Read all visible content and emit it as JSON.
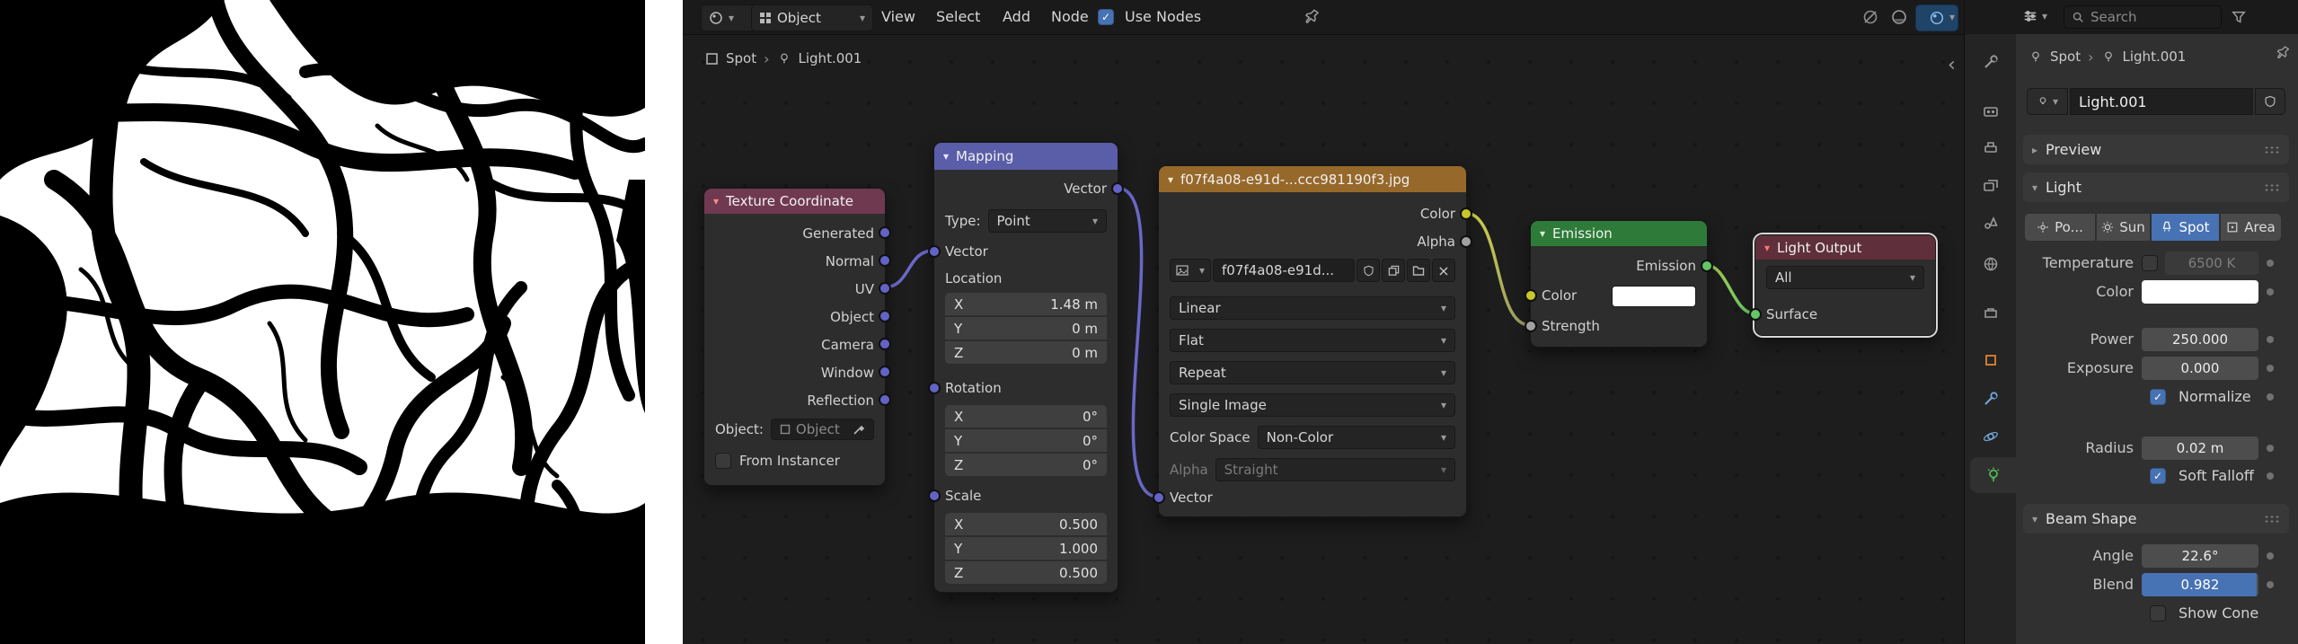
{
  "icons": {
    "chevron_down": "▾",
    "chevron_right": "▸",
    "chevron_left": "‹",
    "breadcrumb_sep": "›",
    "check": "✓",
    "close": "×"
  },
  "node_editor": {
    "header": {
      "mode": "Object",
      "menu_view": "View",
      "menu_select": "Select",
      "menu_add": "Add",
      "menu_node": "Node",
      "use_nodes_label": "Use Nodes"
    },
    "breadcrumb": {
      "scene": "Spot",
      "object": "Light.001"
    },
    "nodes": {
      "texture_coordinate": {
        "title": "Texture Coordinate",
        "outputs": [
          "Generated",
          "Normal",
          "UV",
          "Object",
          "Camera",
          "Window",
          "Reflection"
        ],
        "object_label": "Object:",
        "object_value": "Object",
        "from_instancer": "From Instancer"
      },
      "mapping": {
        "title": "Mapping",
        "output": "Vector",
        "type_label": "Type:",
        "type_value": "Point",
        "vector_label": "Vector",
        "location_label": "Location",
        "rotation_label": "Rotation",
        "scale_label": "Scale",
        "axis_x": "X",
        "axis_y": "Y",
        "axis_z": "Z",
        "location": {
          "x": "1.48 m",
          "y": "0 m",
          "z": "0 m"
        },
        "rotation": {
          "x": "0°",
          "y": "0°",
          "z": "0°"
        },
        "scale": {
          "x": "0.500",
          "y": "1.000",
          "z": "0.500"
        }
      },
      "image_texture": {
        "title": "f07f4a08-e91d-...ccc981190f3.jpg",
        "output_color": "Color",
        "output_alpha": "Alpha",
        "image_name": "f07f4a08-e91d...",
        "interpolation": "Linear",
        "projection": "Flat",
        "extension": "Repeat",
        "source": "Single Image",
        "color_space_label": "Color Space",
        "color_space_value": "Non-Color",
        "alpha_label": "Alpha",
        "alpha_value": "Straight",
        "input": "Vector"
      },
      "emission": {
        "title": "Emission",
        "output": "Emission",
        "color_label": "Color",
        "strength_label": "Strength"
      },
      "light_output": {
        "title": "Light Output",
        "target": "All",
        "input": "Surface"
      }
    }
  },
  "properties": {
    "search_placeholder": "Search",
    "breadcrumb": {
      "scene": "Spot",
      "object": "Light.001"
    },
    "name_value": "Light.001",
    "panels": {
      "preview": "Preview",
      "light": "Light",
      "beam_shape": "Beam Shape"
    },
    "light_types": {
      "point": "Po...",
      "sun": "Sun",
      "spot": "Spot",
      "area": "Area"
    },
    "temperature": {
      "label": "Temperature",
      "value": "6500 K"
    },
    "color_label": "Color",
    "power": {
      "label": "Power",
      "value": "250.000"
    },
    "exposure": {
      "label": "Exposure",
      "value": "0.000"
    },
    "normalize_label": "Normalize",
    "radius": {
      "label": "Radius",
      "value": "0.02 m"
    },
    "soft_falloff_label": "Soft Falloff",
    "angle": {
      "label": "Angle",
      "value": "22.6°"
    },
    "blend": {
      "label": "Blend",
      "value": "0.982"
    },
    "show_cone_label": "Show Cone"
  },
  "colors": {
    "accent": "#4772b3",
    "socket_vector": "#6363c7",
    "socket_color": "#c7c729",
    "socket_shader": "#63c763",
    "socket_value": "#a1a1a1",
    "header_input": "#6f3950",
    "header_vector": "#5a5ea8",
    "header_texture": "#96682a",
    "header_shader": "#2e7b39",
    "header_output": "#5f303c"
  }
}
